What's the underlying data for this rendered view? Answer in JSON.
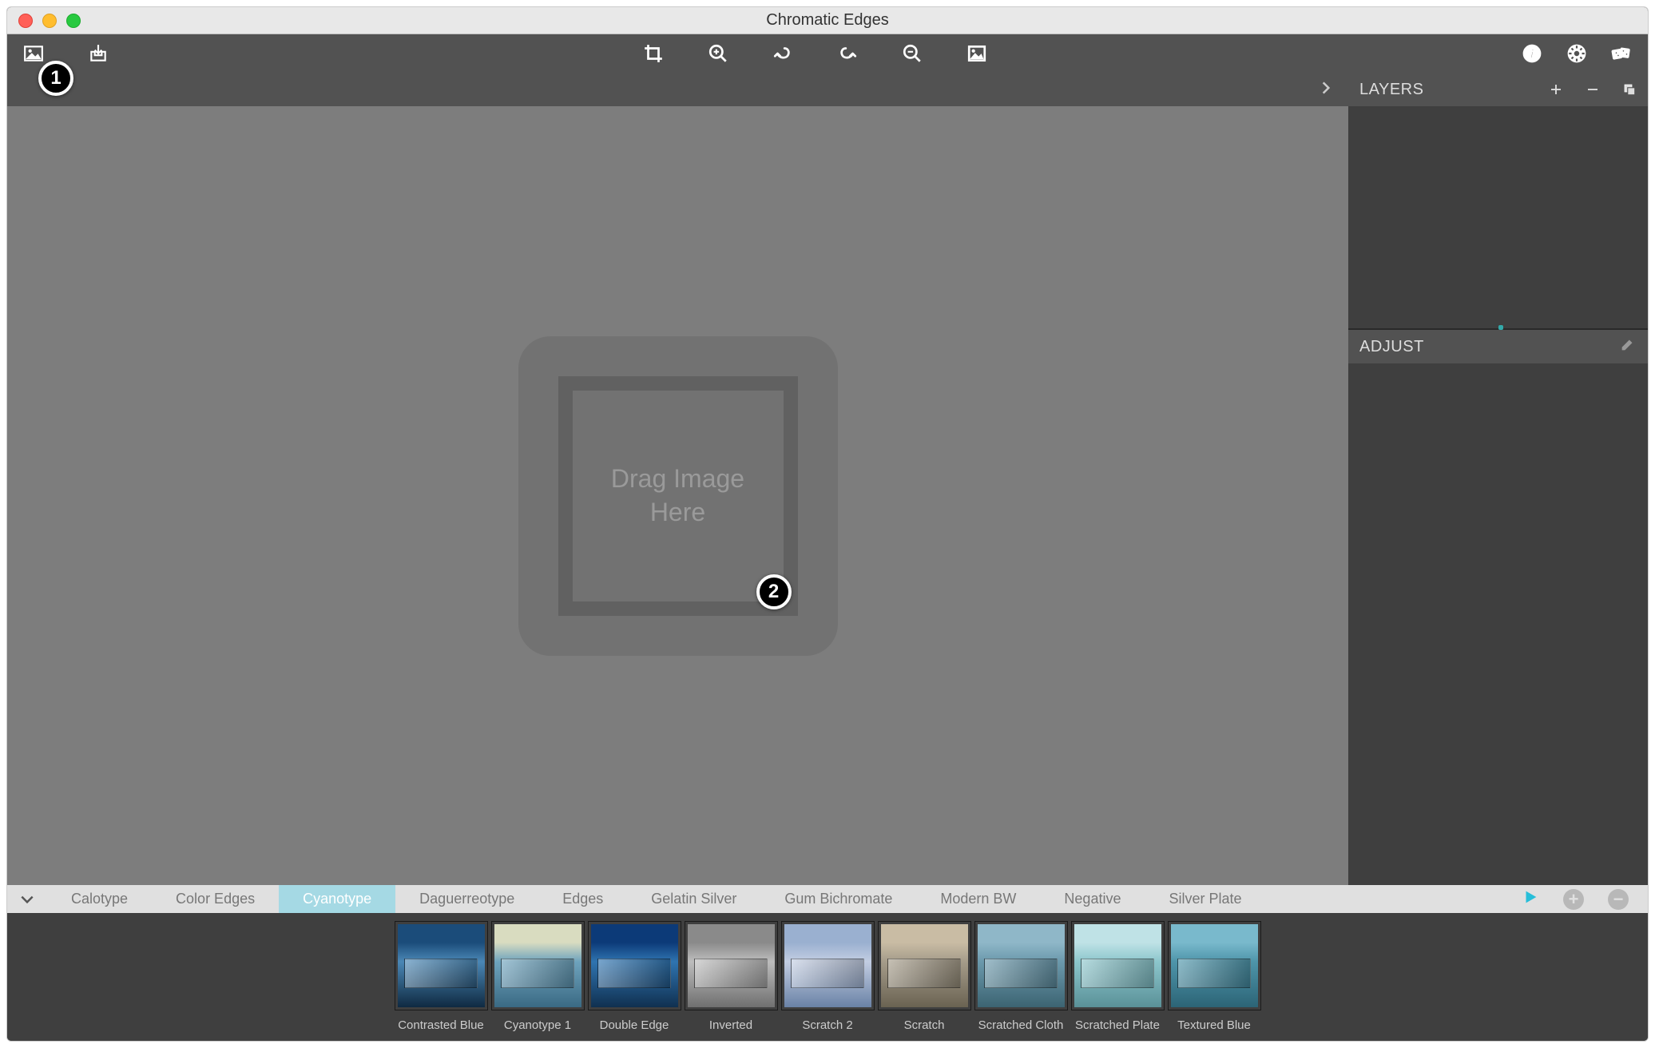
{
  "window_title": "Chromatic Edges",
  "drop_zone": {
    "line1": "Drag Image",
    "line2": "Here"
  },
  "sidebar": {
    "layers_label": "LAYERS",
    "adjust_label": "ADJUST"
  },
  "categories": [
    {
      "label": "Calotype",
      "active": false
    },
    {
      "label": "Color Edges",
      "active": false
    },
    {
      "label": "Cyanotype",
      "active": true
    },
    {
      "label": "Daguerreotype",
      "active": false
    },
    {
      "label": "Edges",
      "active": false
    },
    {
      "label": "Gelatin Silver",
      "active": false
    },
    {
      "label": "Gum Bichromate",
      "active": false
    },
    {
      "label": "Modern BW",
      "active": false
    },
    {
      "label": "Negative",
      "active": false
    },
    {
      "label": "Silver Plate",
      "active": false
    }
  ],
  "presets": [
    {
      "label": "Contrasted Blue",
      "colors": {
        "top": "#1b4c7a",
        "mid": "#4a87b5",
        "bot": "#0f2a42"
      }
    },
    {
      "label": "Cyanotype 1",
      "colors": {
        "top": "#d9dcc0",
        "mid": "#6ea3bd",
        "bot": "#3a6a84"
      }
    },
    {
      "label": "Double Edge",
      "colors": {
        "top": "#0c3a78",
        "mid": "#2f74b0",
        "bot": "#103050"
      }
    },
    {
      "label": "Inverted",
      "colors": {
        "top": "#8a8a8a",
        "mid": "#bdbdbd",
        "bot": "#707070"
      }
    },
    {
      "label": "Scratch 2",
      "colors": {
        "top": "#9ab0d0",
        "mid": "#c2cde2",
        "bot": "#6a82a6"
      }
    },
    {
      "label": "Scratch",
      "colors": {
        "top": "#c9bca4",
        "mid": "#a59c8a",
        "bot": "#6a6352"
      }
    },
    {
      "label": "Scratched Cloth",
      "colors": {
        "top": "#8fb7c8",
        "mid": "#6b99ac",
        "bot": "#3c6472"
      }
    },
    {
      "label": "Scratched Plate",
      "colors": {
        "top": "#bfe2e6",
        "mid": "#8cc6cc",
        "bot": "#5a9198"
      }
    },
    {
      "label": "Textured Blue",
      "colors": {
        "top": "#79b9cc",
        "mid": "#4e95aa",
        "bot": "#2c6476"
      }
    }
  ],
  "badges": {
    "b1": "1",
    "b2": "2"
  }
}
